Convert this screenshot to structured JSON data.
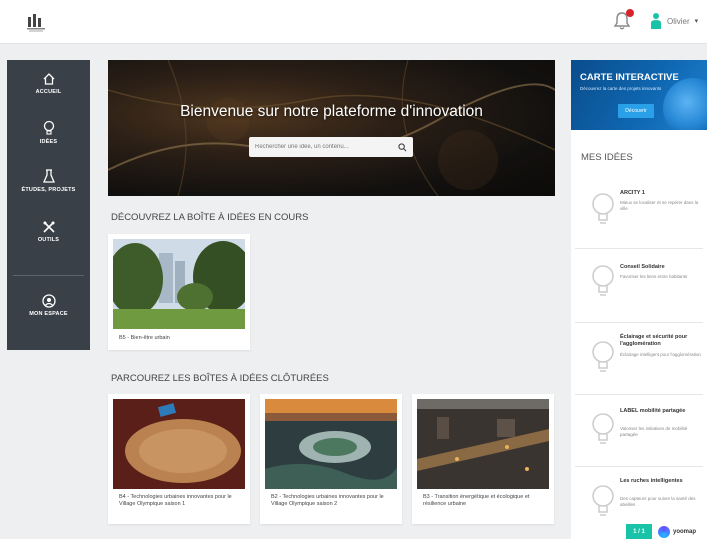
{
  "header": {
    "logo_icon": "city-logo-icon",
    "user_name": "Olivier",
    "caret": "▾"
  },
  "sidebar": {
    "items": [
      {
        "label": "ACCUEIL",
        "icon": "home-icon"
      },
      {
        "label": "IDÉES",
        "icon": "lightbulb-icon"
      },
      {
        "label": "ÉTUDES, PROJETS",
        "icon": "flask-icon"
      },
      {
        "label": "OUTILS",
        "icon": "tools-icon"
      },
      {
        "label": "MON ESPACE",
        "icon": "user-circle-icon"
      }
    ]
  },
  "hero": {
    "title": "Bienvenue sur notre plateforme d'innovation",
    "search_placeholder": "Rechercher une idée, un contenu..."
  },
  "current": {
    "section_title": "DÉCOUVREZ LA BOÎTE À IDÉES EN COURS",
    "cards": [
      {
        "title": "B5 - Bien-être urbain"
      }
    ]
  },
  "closed": {
    "section_title": "PARCOUREZ LES BOÎTES À IDÉES CLÔTURÉES",
    "cards": [
      {
        "title": "B4 - Technologies urbaines innovantes pour le Village Olympique saison 1"
      },
      {
        "title": "B2 - Technologies urbaines innovantes pour le Village Olympique saison 2"
      },
      {
        "title": "B3 - Transition énergétique et écologique et résilience urbaine"
      }
    ]
  },
  "promo": {
    "title": "CARTE INTERACTIVE",
    "subtitle": "Découvrez la carte des projets innovants",
    "button": "Découvrir"
  },
  "my_ideas": {
    "title": "MES IDÉES",
    "items": [
      {
        "title": "ARCITY 1",
        "desc": "Mieux se localiser et se repérer dans la ville"
      },
      {
        "title": "Conseil Solidaire",
        "desc": "Favoriser les liens entre habitants"
      },
      {
        "title": "Éclairage et sécurité pour l'agglomération",
        "desc": "Éclairage intelligent pour l'agglomération"
      },
      {
        "title": "LABEL mobilité partagée",
        "desc": "Valoriser les initiatives de mobilité partagée"
      },
      {
        "title": "Les ruches intelligentes",
        "desc": "Des capteurs pour suivre la santé des abeilles"
      }
    ]
  },
  "footer": {
    "badge": "1 / 1",
    "brand": "yoomap"
  },
  "colors": {
    "sidebar_bg": "#3a4048",
    "promo_blue": "#0f66b0",
    "accent_teal": "#19c3a7",
    "notification_red": "#d8232a"
  }
}
